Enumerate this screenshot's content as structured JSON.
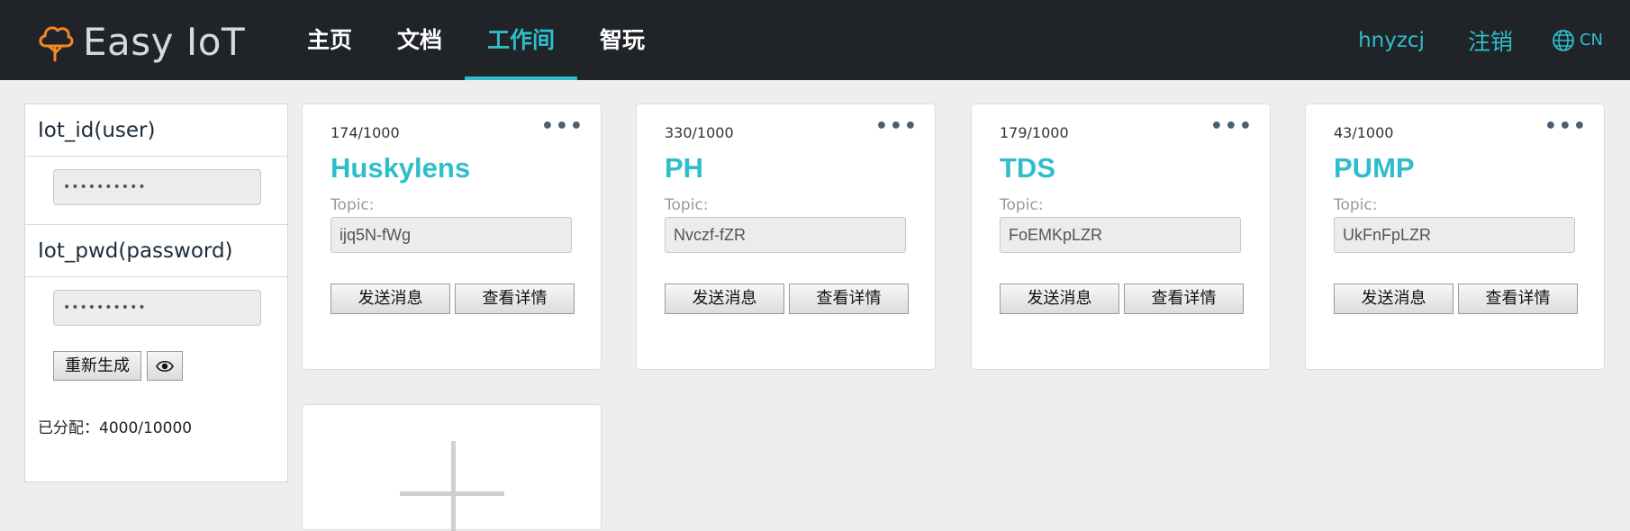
{
  "header": {
    "logo_text": "Easy IoT",
    "nav": [
      {
        "label": "主页",
        "active": false
      },
      {
        "label": "文档",
        "active": false
      },
      {
        "label": "工作间",
        "active": true
      },
      {
        "label": "智玩",
        "active": false
      }
    ],
    "username": "hnyzcj",
    "logout_label": "注销",
    "lang_label": "CN",
    "accent_color": "#2ebecb",
    "bg_color": "#202428"
  },
  "sidebar": {
    "iot_id_label": "Iot_id(user)",
    "iot_id_value": "••••••••••",
    "iot_pwd_label": "Iot_pwd(password)",
    "iot_pwd_value": "••••••••••",
    "regenerate_label": "重新生成",
    "show_icon": "eye-icon",
    "allocated": "已分配：4000/10000"
  },
  "cards": [
    {
      "count": "174/1000",
      "name": "Huskylens",
      "topic_label": "Topic:",
      "topic": "ijq5N-fWg",
      "send_label": "发送消息",
      "detail_label": "查看详情"
    },
    {
      "count": "330/1000",
      "name": "PH",
      "topic_label": "Topic:",
      "topic": "Nvczf-fZR",
      "send_label": "发送消息",
      "detail_label": "查看详情"
    },
    {
      "count": "179/1000",
      "name": "TDS",
      "topic_label": "Topic:",
      "topic": "FoEMKpLZR",
      "send_label": "发送消息",
      "detail_label": "查看详情"
    },
    {
      "count": "43/1000",
      "name": "PUMP",
      "topic_label": "Topic:",
      "topic": "UkFnFpLZR",
      "send_label": "发送消息",
      "detail_label": "查看详情"
    }
  ],
  "more_icon": "more-dots-icon",
  "add_icon": "plus-icon"
}
